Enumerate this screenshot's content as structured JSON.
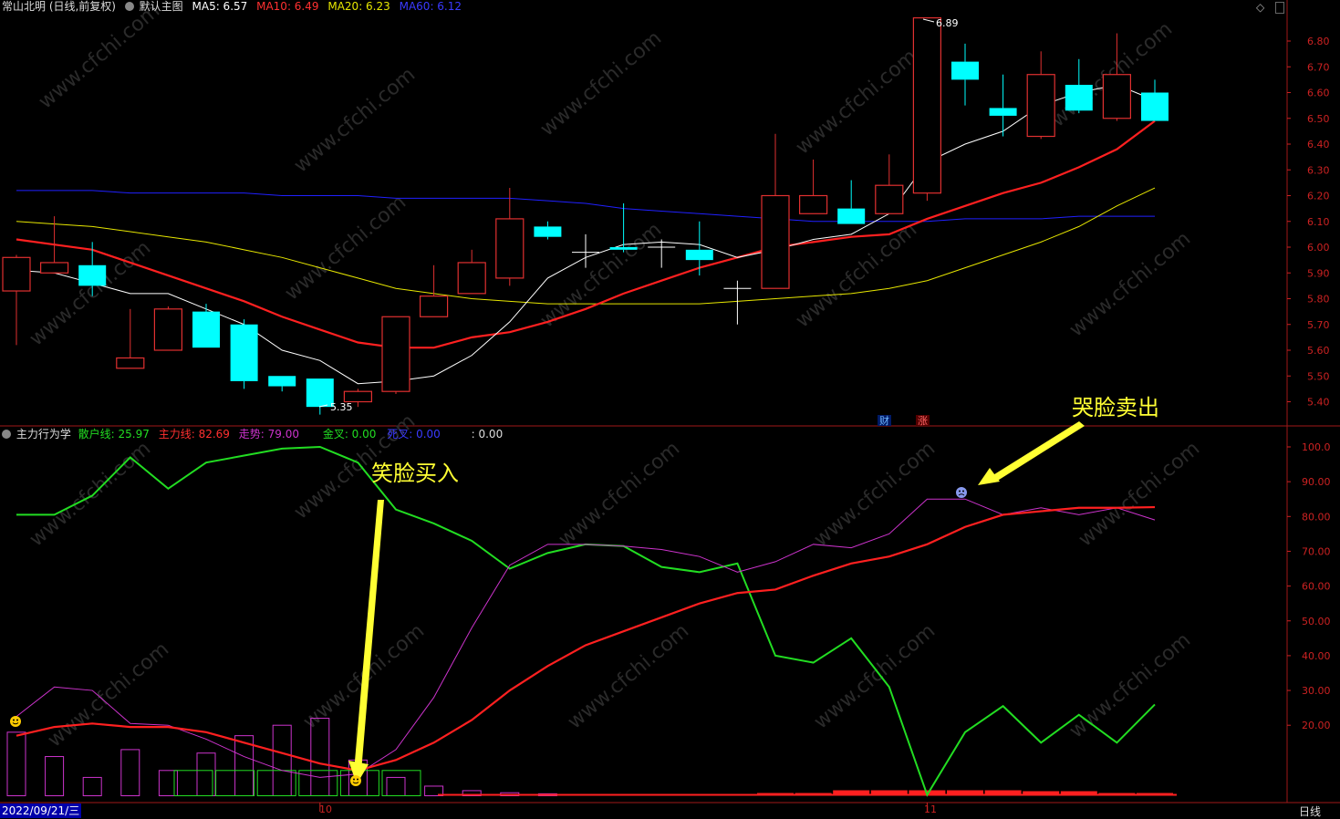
{
  "top_header": {
    "stock_label": "常山北明 (日线,前复权)",
    "template_label": "默认主图",
    "ma5": "MA5: 6.57",
    "ma10": "MA10: 6.49",
    "ma20": "MA20: 6.23",
    "ma60": "MA60: 6.12"
  },
  "indicator_header": {
    "name": "主力行为学",
    "retail": "散户线: 25.97",
    "main": "主力线: 82.69",
    "trend": "走势: 79.00",
    "golden": "金叉: 0.00",
    "death": "死叉: 0.00",
    "extra": ": 0.00"
  },
  "annotations": {
    "buy": "笑脸买入",
    "sell": "哭脸卖出",
    "high_price": "6.89",
    "low_price": "5.35",
    "cai": "财",
    "zhang": "涨"
  },
  "bottom_bar": {
    "date": "2022/09/21/三",
    "month_10": "10",
    "month_11": "11",
    "period": "日线"
  },
  "colors": {
    "up": "#e03030",
    "down": "#00ffff",
    "ma5": "#ffffff",
    "ma10": "#ff2020",
    "ma20": "#e6e600",
    "ma60": "#2020ff",
    "retail": "#22dd22",
    "trend": "#cc33cc",
    "axis": "#cc2222",
    "annotation": "#ffff33"
  },
  "chart_data": [
    {
      "type": "candlestick",
      "title": "常山北明 (日线,前复权)",
      "ylim": [
        5.35,
        6.9
      ],
      "yticks": [
        "6.80",
        "6.70",
        "6.60",
        "6.50",
        "6.40",
        "6.30",
        "6.20",
        "6.10",
        "6.00",
        "5.90",
        "5.80",
        "5.70",
        "5.60",
        "5.50",
        "5.40"
      ],
      "candles": [
        {
          "o": 5.83,
          "c": 5.96,
          "h": 5.97,
          "l": 5.62
        },
        {
          "o": 5.9,
          "c": 5.94,
          "h": 6.12,
          "l": 5.9
        },
        {
          "o": 5.93,
          "c": 5.85,
          "h": 6.02,
          "l": 5.81
        },
        {
          "o": 5.53,
          "c": 5.57,
          "h": 5.76,
          "l": 5.53
        },
        {
          "o": 5.6,
          "c": 5.76,
          "h": 5.77,
          "l": 5.6
        },
        {
          "o": 5.75,
          "c": 5.61,
          "h": 5.78,
          "l": 5.61
        },
        {
          "o": 5.7,
          "c": 5.48,
          "h": 5.72,
          "l": 5.45
        },
        {
          "o": 5.5,
          "c": 5.46,
          "h": 5.5,
          "l": 5.44
        },
        {
          "o": 5.49,
          "c": 5.38,
          "h": 5.49,
          "l": 5.35
        },
        {
          "o": 5.4,
          "c": 5.44,
          "h": 5.45,
          "l": 5.38
        },
        {
          "o": 5.44,
          "c": 5.73,
          "h": 5.73,
          "l": 5.43
        },
        {
          "o": 5.73,
          "c": 5.81,
          "h": 5.93,
          "l": 5.73
        },
        {
          "o": 5.82,
          "c": 5.94,
          "h": 5.99,
          "l": 5.82
        },
        {
          "o": 5.88,
          "c": 6.11,
          "h": 6.23,
          "l": 5.85
        },
        {
          "o": 6.08,
          "c": 6.04,
          "h": 6.1,
          "l": 6.03
        },
        {
          "o": 5.98,
          "c": 5.98,
          "h": 6.05,
          "l": 5.92
        },
        {
          "o": 6.0,
          "c": 5.99,
          "h": 6.17,
          "l": 5.98
        },
        {
          "o": 6.0,
          "c": 6.0,
          "h": 6.03,
          "l": 5.92
        },
        {
          "o": 5.99,
          "c": 5.95,
          "h": 6.1,
          "l": 5.89
        },
        {
          "o": 5.84,
          "c": 5.84,
          "h": 5.87,
          "l": 5.7
        },
        {
          "o": 5.84,
          "c": 6.2,
          "h": 6.44,
          "l": 5.84
        },
        {
          "o": 6.13,
          "c": 6.2,
          "h": 6.34,
          "l": 6.13
        },
        {
          "o": 6.15,
          "c": 6.09,
          "h": 6.26,
          "l": 6.09
        },
        {
          "o": 6.13,
          "c": 6.24,
          "h": 6.36,
          "l": 6.13
        },
        {
          "o": 6.21,
          "c": 6.89,
          "h": 6.89,
          "l": 6.18
        },
        {
          "o": 6.72,
          "c": 6.65,
          "h": 6.79,
          "l": 6.55
        },
        {
          "o": 6.54,
          "c": 6.51,
          "h": 6.67,
          "l": 6.43
        },
        {
          "o": 6.43,
          "c": 6.67,
          "h": 6.76,
          "l": 6.42
        },
        {
          "o": 6.63,
          "c": 6.53,
          "h": 6.73,
          "l": 6.52
        },
        {
          "o": 6.5,
          "c": 6.67,
          "h": 6.83,
          "l": 6.49
        },
        {
          "o": 6.6,
          "c": 6.49,
          "h": 6.65,
          "l": 6.49
        }
      ],
      "ma5": [
        5.91,
        5.9,
        5.86,
        5.82,
        5.82,
        5.76,
        5.7,
        5.6,
        5.56,
        5.47,
        5.48,
        5.5,
        5.58,
        5.71,
        5.88,
        5.96,
        6.01,
        6.02,
        6.01,
        5.96,
        5.99,
        6.03,
        6.05,
        6.13,
        6.33,
        6.4,
        6.45,
        6.55,
        6.6,
        6.63,
        6.57
      ],
      "ma10": [
        6.03,
        6.01,
        5.99,
        5.94,
        5.89,
        5.84,
        5.79,
        5.73,
        5.68,
        5.63,
        5.61,
        5.61,
        5.65,
        5.67,
        5.71,
        5.76,
        5.82,
        5.87,
        5.92,
        5.96,
        6.0,
        6.02,
        6.04,
        6.05,
        6.11,
        6.16,
        6.21,
        6.25,
        6.31,
        6.38,
        6.49
      ],
      "ma20": [
        6.1,
        6.09,
        6.08,
        6.06,
        6.04,
        6.02,
        5.99,
        5.96,
        5.92,
        5.88,
        5.84,
        5.82,
        5.8,
        5.79,
        5.78,
        5.78,
        5.78,
        5.78,
        5.78,
        5.79,
        5.8,
        5.81,
        5.82,
        5.84,
        5.87,
        5.92,
        5.97,
        6.02,
        6.08,
        6.16,
        6.23
      ],
      "ma60": [
        6.22,
        6.22,
        6.22,
        6.21,
        6.21,
        6.21,
        6.21,
        6.2,
        6.2,
        6.2,
        6.19,
        6.19,
        6.19,
        6.19,
        6.18,
        6.17,
        6.15,
        6.14,
        6.13,
        6.12,
        6.11,
        6.1,
        6.1,
        6.1,
        6.1,
        6.11,
        6.11,
        6.11,
        6.12,
        6.12,
        6.12
      ]
    },
    {
      "type": "line",
      "title": "主力行为学",
      "ylim": [
        0,
        105
      ],
      "yticks": [
        "100.0",
        "90.00",
        "80.00",
        "70.00",
        "60.00",
        "50.00",
        "40.00",
        "30.00",
        "20.00"
      ],
      "series": [
        {
          "name": "散户线",
          "values": [
            80.5,
            80.5,
            86,
            97,
            88,
            95.5,
            97.5,
            99.5,
            100,
            95.5,
            82,
            78,
            73,
            65,
            69.5,
            72,
            71.5,
            65.5,
            64,
            66.5,
            40,
            38,
            45,
            31,
            0,
            18,
            25.5,
            15,
            23,
            15,
            25.97
          ]
        },
        {
          "name": "主力线",
          "values": [
            17,
            19.5,
            20.5,
            19.5,
            19.5,
            18,
            15,
            12,
            9,
            7,
            10,
            15,
            21.5,
            30,
            37,
            43,
            47,
            51,
            55,
            58,
            59,
            63,
            66.5,
            68.5,
            72,
            77,
            80.5,
            81.5,
            82.5,
            82.5,
            82.69
          ]
        },
        {
          "name": "走势",
          "values": [
            22.5,
            31,
            30,
            20.5,
            20,
            16,
            11,
            7,
            5,
            6,
            13,
            28,
            48,
            66,
            72,
            72,
            71.5,
            70.5,
            68.5,
            64,
            67,
            72,
            71,
            75,
            85,
            85,
            80.5,
            82.5,
            80.5,
            82.5,
            79
          ]
        }
      ],
      "bars": [
        18,
        11,
        5,
        13,
        7,
        12,
        17,
        20,
        22,
        10,
        5,
        2.5,
        1.2,
        0.6,
        0.3,
        0,
        0,
        0,
        0,
        0
      ],
      "flat_boxes": [
        7,
        7,
        7,
        7,
        7,
        7
      ]
    }
  ]
}
